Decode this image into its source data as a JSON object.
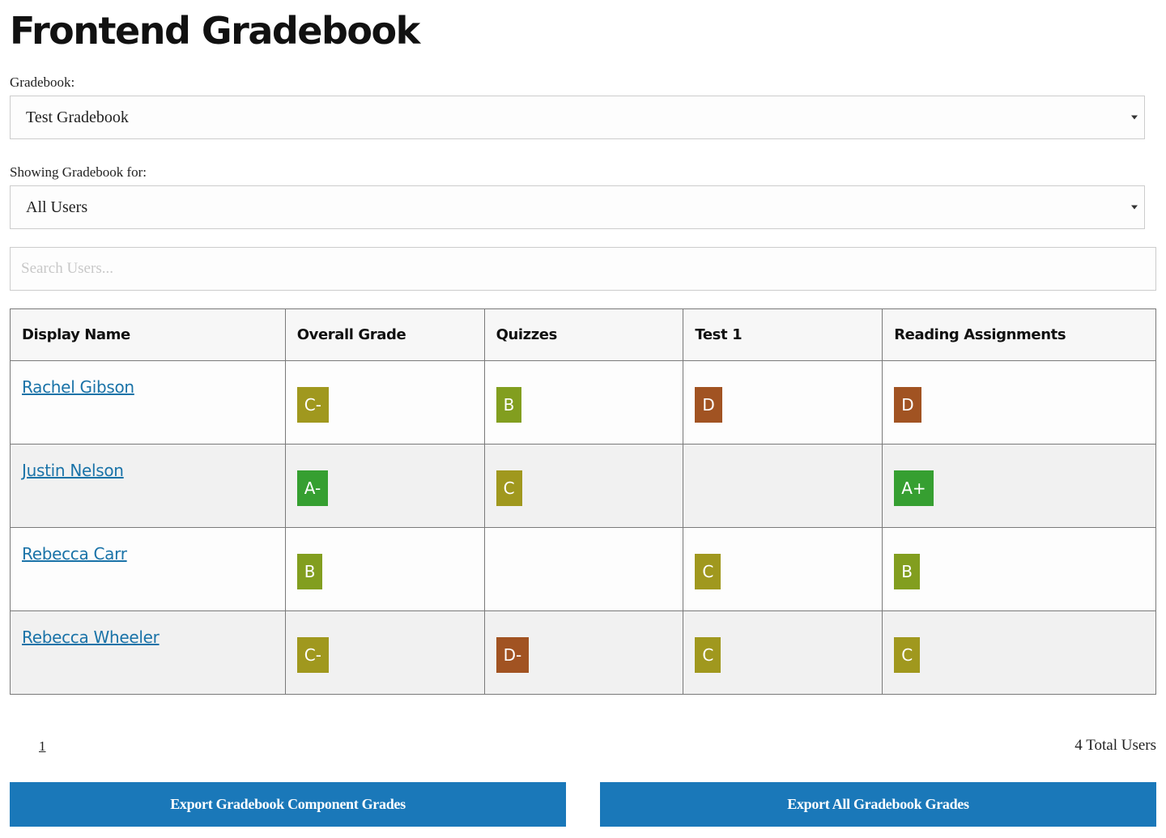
{
  "header": {
    "title": "Frontend Gradebook"
  },
  "filters": {
    "gradebook_label": "Gradebook:",
    "gradebook_value": "Test Gradebook",
    "showing_label": "Showing Gradebook for:",
    "showing_value": "All Users",
    "search_placeholder": "Search Users...",
    "search_value": ""
  },
  "grade_colors": {
    "A": "#369f31",
    "B": "#829e1f",
    "C": "#a0981e",
    "D": "#a15322"
  },
  "table": {
    "columns": [
      "Display Name",
      "Overall Grade",
      "Quizzes",
      "Test 1",
      "Reading Assignments"
    ],
    "rows": [
      {
        "name": "Rachel Gibson",
        "overall": "C-",
        "quizzes": "B",
        "test1": "D",
        "reading": "D"
      },
      {
        "name": "Justin Nelson",
        "overall": "A-",
        "quizzes": "C",
        "test1": "",
        "reading": "A+"
      },
      {
        "name": "Rebecca Carr",
        "overall": "B",
        "quizzes": "",
        "test1": "C",
        "reading": "B"
      },
      {
        "name": "Rebecca Wheeler",
        "overall": "C-",
        "quizzes": "D-",
        "test1": "C",
        "reading": "C"
      }
    ]
  },
  "pagination": {
    "current_page": "1",
    "total_users": "4 Total Users"
  },
  "actions": {
    "export_component_label": "Export Gradebook Component Grades",
    "export_all_label": "Export All Gradebook Grades"
  }
}
